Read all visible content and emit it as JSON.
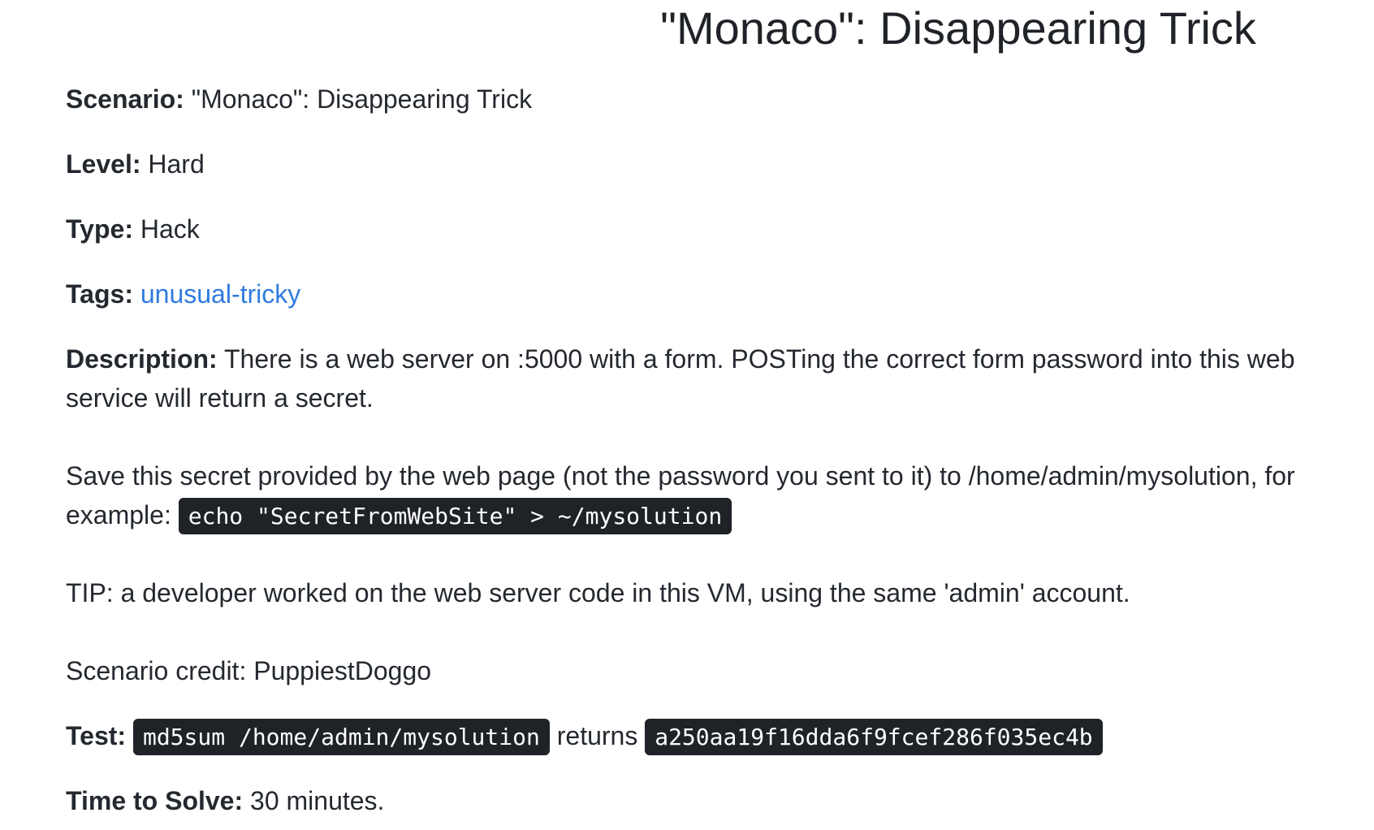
{
  "title": "\"Monaco\": Disappearing Trick",
  "scenario": {
    "label": "Scenario:",
    "value": " \"Monaco\": Disappearing Trick"
  },
  "level": {
    "label": "Level:",
    "value": " Hard"
  },
  "type": {
    "label": "Type:",
    "value": " Hack"
  },
  "tags": {
    "label": "Tags:",
    "link": "unusual-tricky"
  },
  "description": {
    "label": "Description:",
    "text": " There is a web server on :5000 with a form. POSTing the correct form password into this web service will return a secret."
  },
  "save": {
    "text": "Save this secret provided by the web page (not the password you sent to it) to /home/admin/mysolution, for example: ",
    "code": "echo \"SecretFromWebSite\" > ~/mysolution"
  },
  "tip": "TIP: a developer worked on the web server code in this VM, using the same 'admin' account.",
  "credit": "Scenario credit: PuppiestDoggo",
  "test": {
    "label": "Test:",
    "command": "md5sum /home/admin/mysolution",
    "returns": " returns ",
    "hash": "a250aa19f16dda6f9fcef286f035ec4b"
  },
  "time": {
    "label": "Time to Solve:",
    "value": " 30 minutes."
  },
  "colors": {
    "text": "#24292f",
    "link": "#2f7be0",
    "code_bg": "#1f2328",
    "code_fg": "#ffffff"
  }
}
